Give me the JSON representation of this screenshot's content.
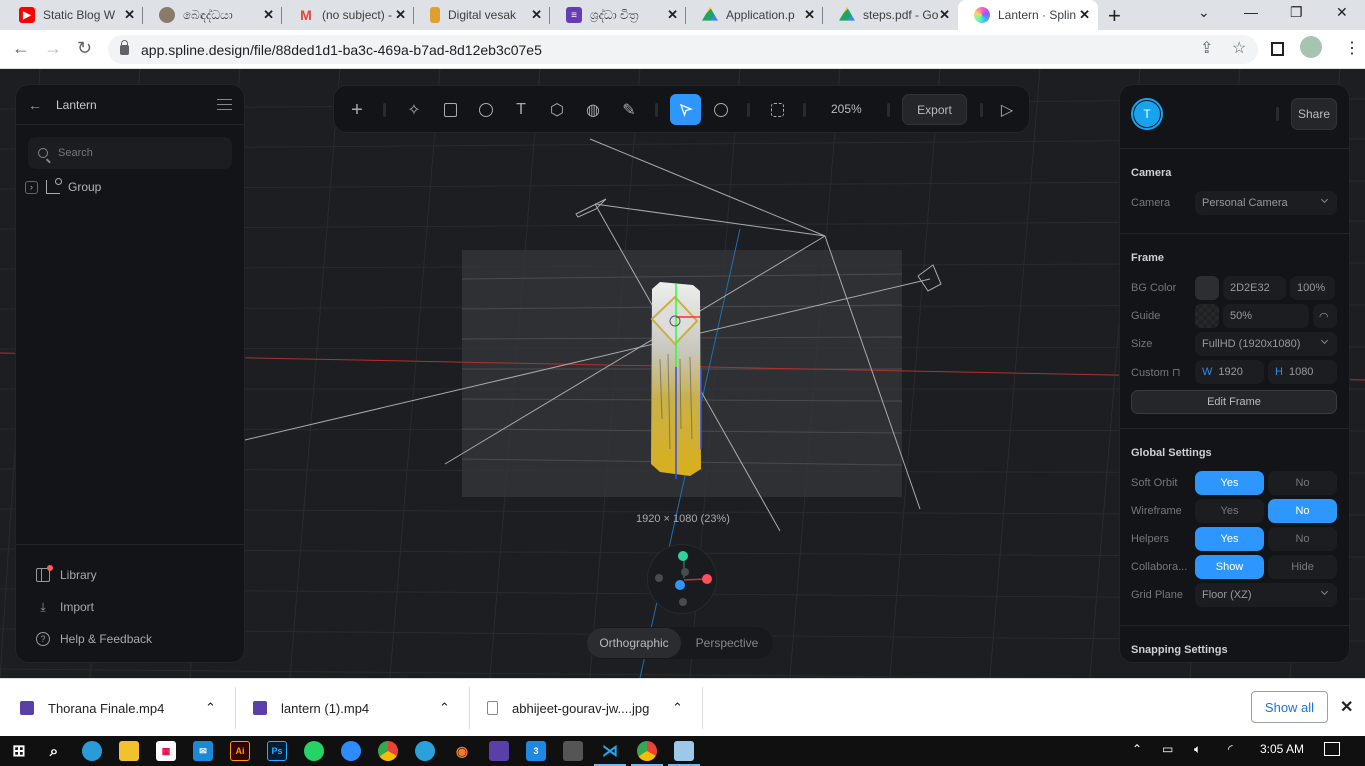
{
  "browser": {
    "tabs": [
      {
        "title": "Static Blog W",
        "favicon": "youtube-icon",
        "color": "#ff0000",
        "active": false
      },
      {
        "title": "බෙඳද්ධයා",
        "favicon": "site-icon",
        "color": "#8a7a6a",
        "active": false
      },
      {
        "title": "(no subject) -",
        "favicon": "gmail-icon",
        "color": "#ea4335",
        "active": false
      },
      {
        "title": "Digital vesak",
        "favicon": "lantern-site-icon",
        "color": "#e0a030",
        "active": false
      },
      {
        "title": "ශ්‍රද්ධා චිත්‍ර",
        "favicon": "forms-icon",
        "color": "#673ab7",
        "active": false
      },
      {
        "title": "Application.p",
        "favicon": "drive-icon",
        "color": "#1fa463",
        "active": false
      },
      {
        "title": "steps.pdf - Go",
        "favicon": "drive-icon",
        "color": "#1fa463",
        "active": false
      },
      {
        "title": "Lantern · Splin",
        "favicon": "spline-icon",
        "color": "#8a5cff",
        "active": true
      }
    ],
    "new_tab_label": "+",
    "url": "app.spline.design/file/88ded1d1-ba3c-469a-b7ad-8d12eb3c07e5"
  },
  "left_panel": {
    "file_name": "Lantern",
    "search_placeholder": "Search",
    "tree": [
      {
        "label": "Group"
      }
    ],
    "bottom_links": [
      {
        "label": "Library",
        "icon": "library-icon"
      },
      {
        "label": "Import",
        "icon": "import-icon"
      },
      {
        "label": "Help & Feedback",
        "icon": "help-icon"
      }
    ]
  },
  "toolbar": {
    "zoom": "205%",
    "export_label": "Export",
    "tools": [
      "add",
      "sparkle",
      "rectangle",
      "ellipse",
      "text",
      "cube",
      "sphere",
      "pen",
      "select",
      "comment",
      "frame",
      "play"
    ],
    "active_tool": "select"
  },
  "right_panel": {
    "user_initial": "T",
    "share_label": "Share",
    "camera": {
      "title": "Camera",
      "label": "Camera",
      "value": "Personal Camera"
    },
    "frame": {
      "title": "Frame",
      "bg_color_label": "BG Color",
      "bg_color_hex": "2D2E32",
      "bg_opacity": "100%",
      "guide_label": "Guide",
      "guide_value": "50%",
      "size_label": "Size",
      "size_value": "FullHD (1920x1080)",
      "custom_label": "Custom",
      "w_label": "W",
      "w_value": "1920",
      "h_label": "H",
      "h_value": "1080",
      "edit_frame_label": "Edit Frame"
    },
    "global_settings": {
      "title": "Global Settings",
      "rows": [
        {
          "label": "Soft Orbit",
          "options": [
            "Yes",
            "No"
          ],
          "selected": "Yes"
        },
        {
          "label": "Wireframe",
          "options": [
            "Yes",
            "No"
          ],
          "selected": "No"
        },
        {
          "label": "Helpers",
          "options": [
            "Yes",
            "No"
          ],
          "selected": "Yes"
        },
        {
          "label": "Collabora...",
          "options": [
            "Show",
            "Hide"
          ],
          "selected": "Show"
        }
      ],
      "grid_plane_label": "Grid Plane",
      "grid_plane_value": "Floor (XZ)"
    },
    "snapping_title": "Snapping Settings"
  },
  "viewport": {
    "frame_size_label": "1920 × 1080 (23%)",
    "projection": {
      "options": [
        "Orthographic",
        "Perspective"
      ],
      "selected": "Orthographic"
    }
  },
  "downloads": {
    "items": [
      {
        "name": "Thorana Finale.mp4",
        "icon": "video-file-icon"
      },
      {
        "name": "lantern (1).mp4",
        "icon": "video-file-icon"
      },
      {
        "name": "abhijeet-gourav-jw....jpg",
        "icon": "image-file-icon"
      }
    ],
    "show_all_label": "Show all"
  },
  "taskbar": {
    "clock": "3:05 AM",
    "apps": [
      "windows-start",
      "search",
      "edge",
      "file-explorer",
      "store",
      "mail",
      "illustrator",
      "photoshop",
      "whatsapp",
      "zoom",
      "chrome",
      "telegram",
      "blender",
      "media-player",
      "3d-app",
      "app",
      "vscode",
      "chrome-active",
      "notepad"
    ]
  },
  "colors": {
    "accent": "#2D97FF",
    "panel_bg": "#131417",
    "viewport_bg": "#1D1E21",
    "avatar": "#16A3F0"
  }
}
